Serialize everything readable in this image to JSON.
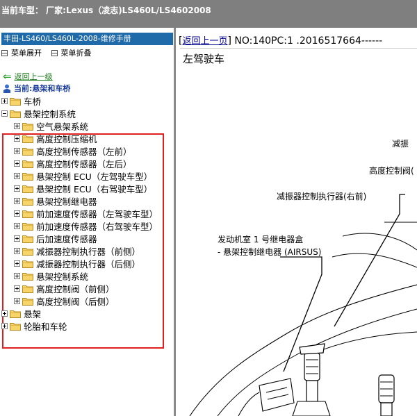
{
  "window": {
    "title": "当前车型：  厂家:Lexus（凌志)LS460L/LS4602008"
  },
  "sidebar": {
    "panel_title": "丰田-LS460/LS460L-2008-维修手册",
    "menu": {
      "expand": "菜单展开",
      "collapse": "菜单折叠"
    },
    "back_link": "返回上一级",
    "current": "当前:悬架和车桥",
    "tree": [
      {
        "label": "车桥"
      },
      {
        "label": "悬架控制系统"
      },
      {
        "label": "空气悬架系统"
      },
      {
        "label": "高度控制压缩机"
      },
      {
        "label": "高度控制传感器（左前）"
      },
      {
        "label": "高度控制传感器（左后）"
      },
      {
        "label": "悬架控制 ECU（左驾驶车型）"
      },
      {
        "label": "悬架控制 ECU（右驾驶车型）"
      },
      {
        "label": "悬架控制继电器"
      },
      {
        "label": "前加速度传感器（左驾驶车型）"
      },
      {
        "label": "前加速度传感器（右驾驶车型）"
      },
      {
        "label": "后加速度传感器"
      },
      {
        "label": "减振器控制执行器（前侧）"
      },
      {
        "label": "减振器控制执行器（后侧）"
      },
      {
        "label": "悬架控制系统"
      },
      {
        "label": "高度控制阀（前侧）"
      },
      {
        "label": "高度控制阀（后侧）"
      },
      {
        "label": "悬架"
      },
      {
        "label": "轮胎和车轮"
      }
    ]
  },
  "content": {
    "back_link": "返回上一页",
    "doc_no": "NO:140PC:1 .2016517664------",
    "subtitle": "左驾驶车",
    "diagram_labels": {
      "absorber_cut": "减振",
      "valve_cut": "高度控制阀(",
      "actuator_front_right": "减振器控制执行器(右前)",
      "relay_box": "发动机室 1 号继电器盒",
      "relay": "- 悬架控制继电器 (AIRSUS)"
    }
  },
  "colors": {
    "title_bar": "#7f7f7f",
    "panel_title": "#1f6aa8",
    "highlight_box": "#e01e1e",
    "link": "#00008b"
  }
}
